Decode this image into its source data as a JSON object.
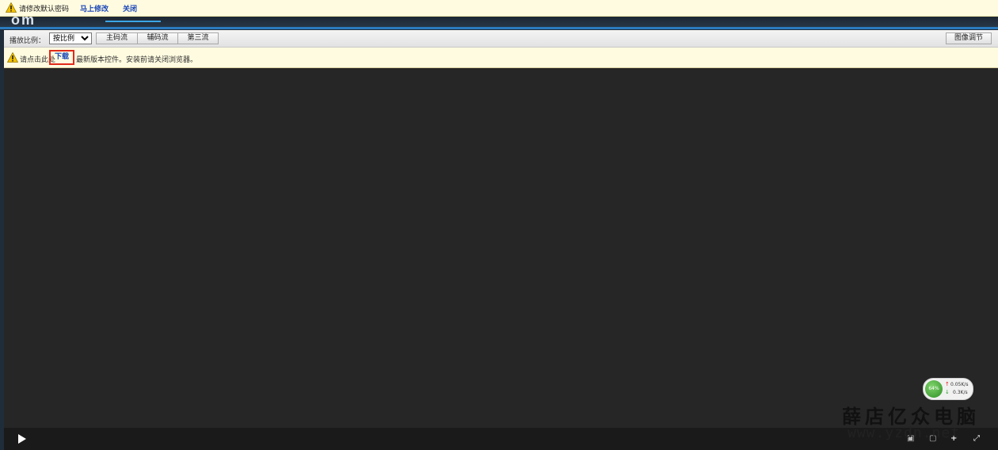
{
  "top_notice": {
    "message": "请修改默认密码",
    "modify_link": "马上修改",
    "close_link": "关闭"
  },
  "header": {
    "logo_fragment": "om"
  },
  "toolbar": {
    "ratio_label": "播放比例：",
    "ratio_selected": "按比例",
    "streams": {
      "main": "主码流",
      "sub": "辅码流",
      "third": "第三流"
    },
    "image_adjust": "图像调节"
  },
  "plugin_notice": {
    "prefix": "请点击此处",
    "download_link": "下载",
    "suffix": "最新版本控件。安装前请关闭浏览器。"
  },
  "network_widget": {
    "percent": "64%",
    "upload": "0.05K/s",
    "download": "0.3K/s"
  },
  "watermark": {
    "cn": "薛店亿众电脑",
    "url": "www.yzdn.net"
  },
  "icons": {
    "warning": "warning-triangle-icon",
    "play": "play-icon",
    "record": "record-icon",
    "snapshot": "snapshot-icon",
    "zoom": "zoom-icon",
    "fullscreen": "fullscreen-icon"
  },
  "colors": {
    "link": "#1a47b8",
    "highlight_box": "#e02a1a",
    "notice_bg": "#fffbe0",
    "video_bg": "#262626"
  }
}
